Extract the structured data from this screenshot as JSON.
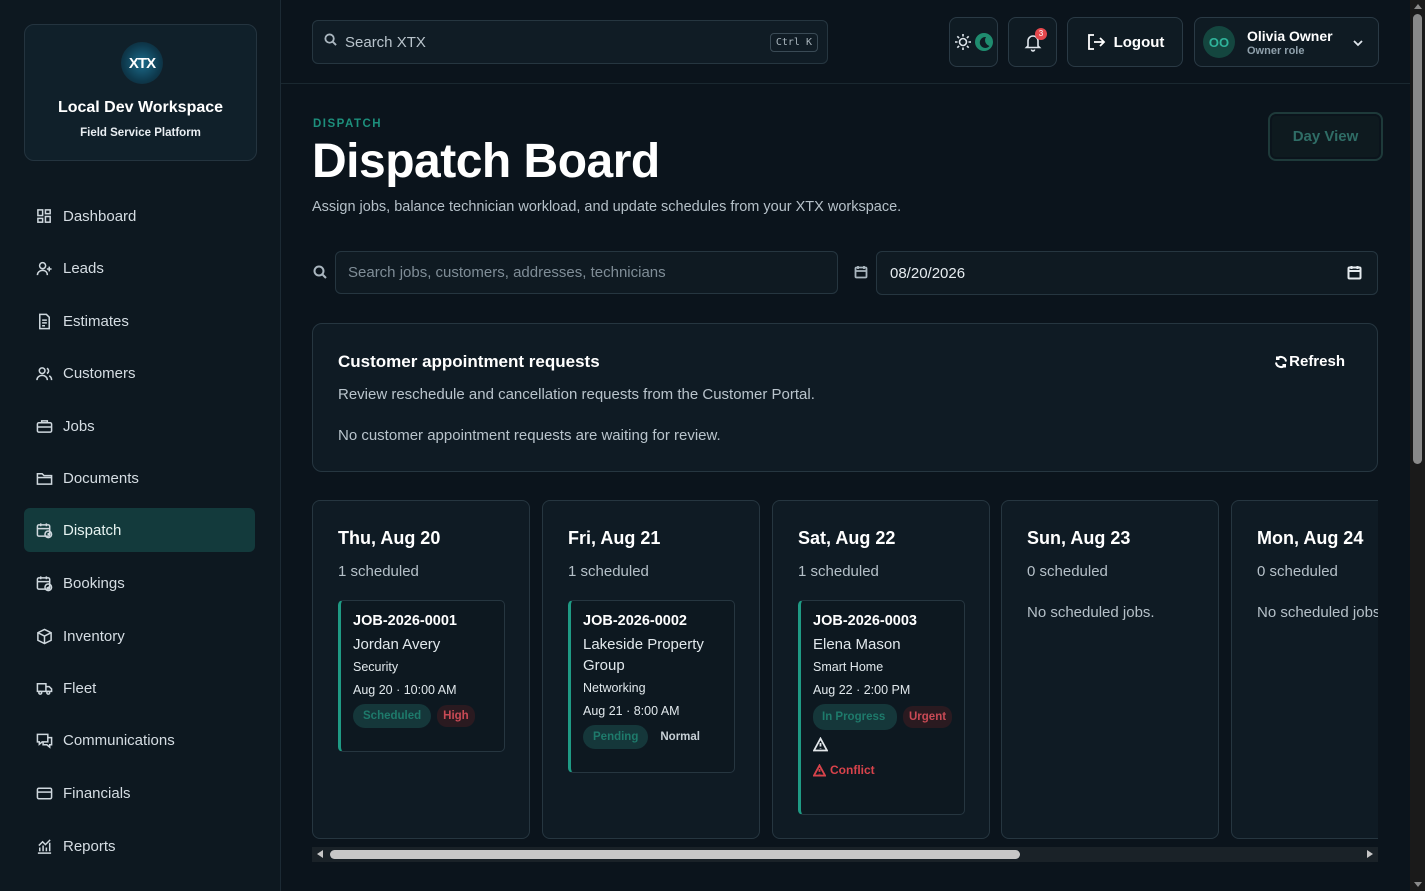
{
  "workspace": {
    "logo_text": "XTX",
    "name": "Local Dev Workspace",
    "subtitle": "Field Service Platform"
  },
  "sidebar": {
    "items": [
      {
        "label": "Dashboard",
        "icon": "grid-icon",
        "active": false
      },
      {
        "label": "Leads",
        "icon": "user-plus-icon",
        "active": false
      },
      {
        "label": "Estimates",
        "icon": "document-icon",
        "active": false
      },
      {
        "label": "Customers",
        "icon": "users-icon",
        "active": false
      },
      {
        "label": "Jobs",
        "icon": "briefcase-icon",
        "active": false
      },
      {
        "label": "Documents",
        "icon": "folder-icon",
        "active": false
      },
      {
        "label": "Dispatch",
        "icon": "calendar-clock-icon",
        "active": true
      },
      {
        "label": "Bookings",
        "icon": "calendar-check-icon",
        "active": false
      },
      {
        "label": "Inventory",
        "icon": "package-icon",
        "active": false
      },
      {
        "label": "Fleet",
        "icon": "truck-icon",
        "active": false
      },
      {
        "label": "Communications",
        "icon": "chat-icon",
        "active": false
      },
      {
        "label": "Financials",
        "icon": "credit-card-icon",
        "active": false
      },
      {
        "label": "Reports",
        "icon": "chart-icon",
        "active": false
      }
    ]
  },
  "topbar": {
    "search_placeholder": "Search XTX",
    "search_shortcut": "Ctrl K",
    "notification_count": "3",
    "logout_label": "Logout",
    "user_initials": "OO",
    "user_name": "Olivia Owner",
    "user_role": "Owner role"
  },
  "page": {
    "eyebrow": "DISPATCH",
    "title": "Dispatch Board",
    "subtitle": "Assign jobs, balance technician workload, and update schedules from your XTX workspace.",
    "day_view_label": "Day View"
  },
  "filters": {
    "search_placeholder": "Search jobs, customers, addresses, technicians",
    "date_value": "08/20/2026"
  },
  "requests": {
    "title": "Customer appointment requests",
    "description": "Review reschedule and cancellation requests from the Customer Portal.",
    "empty_text": "No customer appointment requests are waiting for review.",
    "refresh_label": "Refresh"
  },
  "board": {
    "days": [
      {
        "title": "Thu, Aug 20",
        "count": "1 scheduled",
        "jobs": [
          {
            "id": "JOB-2026-0001",
            "customer": "Jordan Avery",
            "type": "Security",
            "time": "Aug 20 · 10:00 AM",
            "status": "Scheduled",
            "priority": "High"
          }
        ]
      },
      {
        "title": "Fri, Aug 21",
        "count": "1 scheduled",
        "jobs": [
          {
            "id": "JOB-2026-0002",
            "customer": "Lakeside Property Group",
            "type": "Networking",
            "time": "Aug 21 · 8:00 AM",
            "status": "Pending",
            "priority": "Normal"
          }
        ]
      },
      {
        "title": "Sat, Aug 22",
        "count": "1 scheduled",
        "jobs": [
          {
            "id": "JOB-2026-0003",
            "customer": "Elena Mason",
            "type": "Smart Home",
            "time": "Aug 22 · 2:00 PM",
            "status": "In Progress",
            "priority": "Urgent",
            "conflict": "Conflict"
          }
        ]
      },
      {
        "title": "Sun, Aug 23",
        "count": "0 scheduled",
        "empty": "No scheduled jobs."
      },
      {
        "title": "Mon, Aug 24",
        "count": "0 scheduled",
        "empty": "No scheduled jobs."
      }
    ]
  },
  "colors": {
    "background": "#0b141c",
    "accent": "#1f9a84",
    "active_nav": "#133a3c",
    "danger": "#d8434b"
  }
}
